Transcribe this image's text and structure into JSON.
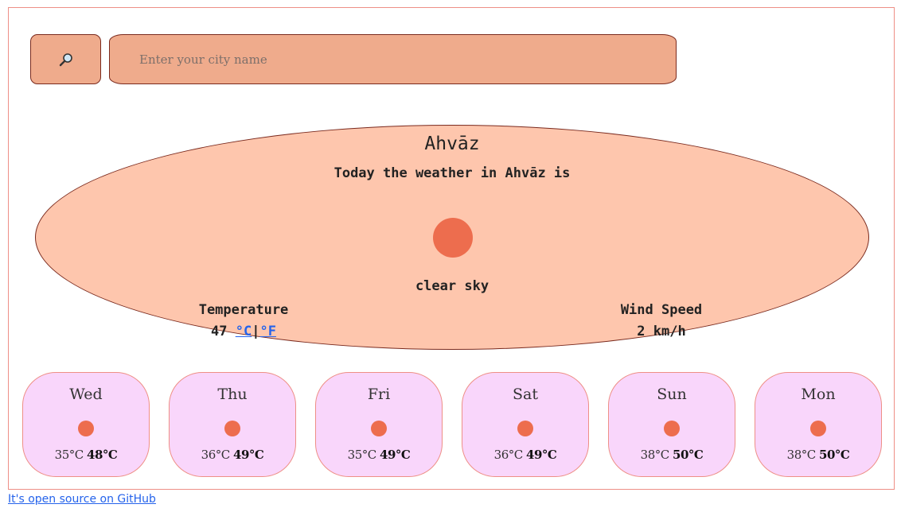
{
  "search": {
    "placeholder": "Enter your city name"
  },
  "icons": {
    "search": "magnifier-icon",
    "weather": "sun-icon"
  },
  "colors": {
    "accent": "#ed6d4e",
    "panel": "#fec6ad",
    "card": "#f9d6fb",
    "search": "#efab8c"
  },
  "today": {
    "city": "Ahvāz",
    "headline": "Today the weather in Ahvāz is",
    "description": "clear sky",
    "temperature_label": "Temperature",
    "temperature_value": "47",
    "unit_c": "°C",
    "unit_sep": "|",
    "unit_f": "°F",
    "wind_label": "Wind Speed",
    "wind_value": "2 km/h"
  },
  "forecast": [
    {
      "day": "Wed",
      "min": "35°C",
      "max": "48°C"
    },
    {
      "day": "Thu",
      "min": "36°C",
      "max": "49°C"
    },
    {
      "day": "Fri",
      "min": "35°C",
      "max": "49°C"
    },
    {
      "day": "Sat",
      "min": "36°C",
      "max": "49°C"
    },
    {
      "day": "Sun",
      "min": "38°C",
      "max": "50°C"
    },
    {
      "day": "Mon",
      "min": "38°C",
      "max": "50°C"
    }
  ],
  "footer": {
    "link_text": "It's open source on GitHub"
  }
}
